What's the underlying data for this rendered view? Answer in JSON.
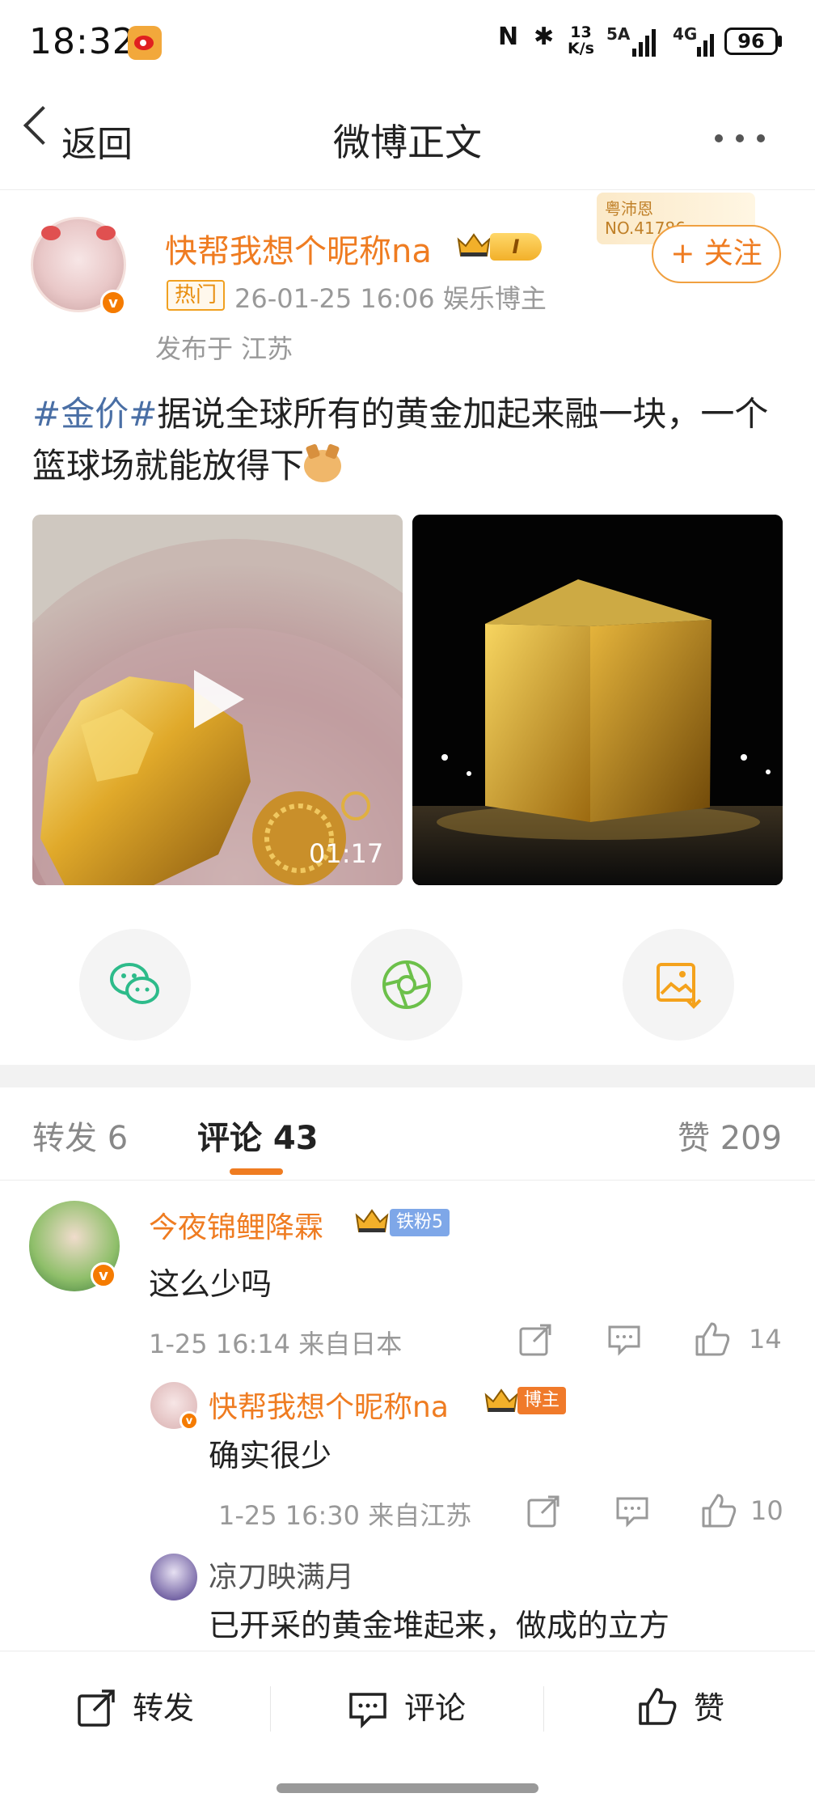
{
  "status_bar": {
    "time": "18:32",
    "nfc": "N",
    "bluetooth": "✱",
    "speed_top": "13",
    "speed_bottom": "K/s",
    "signal1_label": "5A",
    "signal2_label": "4G",
    "battery": "96"
  },
  "nav": {
    "back_label": "返回",
    "title": "微博正文"
  },
  "post": {
    "author_name": "快帮我想个昵称na",
    "level_badge": "I",
    "hot_tag": "热门",
    "time_and_role": "26-01-25 16:06  娱乐博主",
    "location": "发布于 江苏",
    "fan_card_line1": "粤沛恩",
    "fan_card_line2": "NO.41786",
    "follow_label": "+ 关注",
    "topic": "#金价#",
    "text": "据说全球所有的黄金加起来融一块，一个篮球场就能放得下",
    "video_duration": "01:17"
  },
  "tabs": {
    "repost": "转发 6",
    "comment": "评论 43",
    "like": "赞 209"
  },
  "comments": [
    {
      "name": "今夜锦鲤降霖",
      "badge": "铁粉5",
      "text": "这么少吗",
      "meta": "1-25 16:14 来自日本",
      "likes": "14"
    }
  ],
  "replies": [
    {
      "name": "快帮我想个昵称na",
      "badge": "博主",
      "text": "确实很少",
      "meta": "1-25 16:30 来自江苏",
      "likes": "10"
    },
    {
      "name": "凉刀映满月",
      "text": "已开采的黄金堆起来，做成的立方"
    }
  ],
  "bottom_bar": {
    "repost": "转发",
    "comment": "评论",
    "like": "赞"
  },
  "colors": {
    "accent_orange": "#ef7c21",
    "topic_blue": "#4a6fa5",
    "wechat_green": "#2dbb8a",
    "moments_green": "#6cc04a",
    "save_orange": "#f4a21c"
  }
}
